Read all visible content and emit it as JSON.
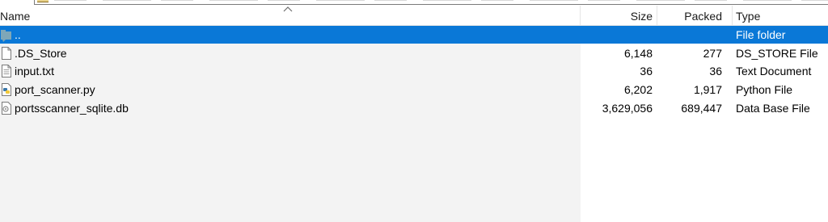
{
  "columns": {
    "name": "Name",
    "size": "Size",
    "packed": "Packed",
    "type": "Type"
  },
  "rows": [
    {
      "name": "..",
      "size": "",
      "packed": "",
      "type": "File folder",
      "icon": "folder-up-icon",
      "selected": true
    },
    {
      "name": ".DS_Store",
      "size": "6,148",
      "packed": "277",
      "type": "DS_STORE File",
      "icon": "file-icon"
    },
    {
      "name": "input.txt",
      "size": "36",
      "packed": "36",
      "type": "Text Document",
      "icon": "text-file-icon"
    },
    {
      "name": "port_scanner.py",
      "size": "6,202",
      "packed": "1,917",
      "type": "Python File",
      "icon": "python-file-icon"
    },
    {
      "name": "portsscanner_sqlite.db",
      "size": "3,629,056",
      "packed": "689,447",
      "type": "Data Base File",
      "icon": "database-file-icon"
    }
  ],
  "colors": {
    "selection": "#0a78d7",
    "left_pane_bg": "#f3f3f3"
  }
}
